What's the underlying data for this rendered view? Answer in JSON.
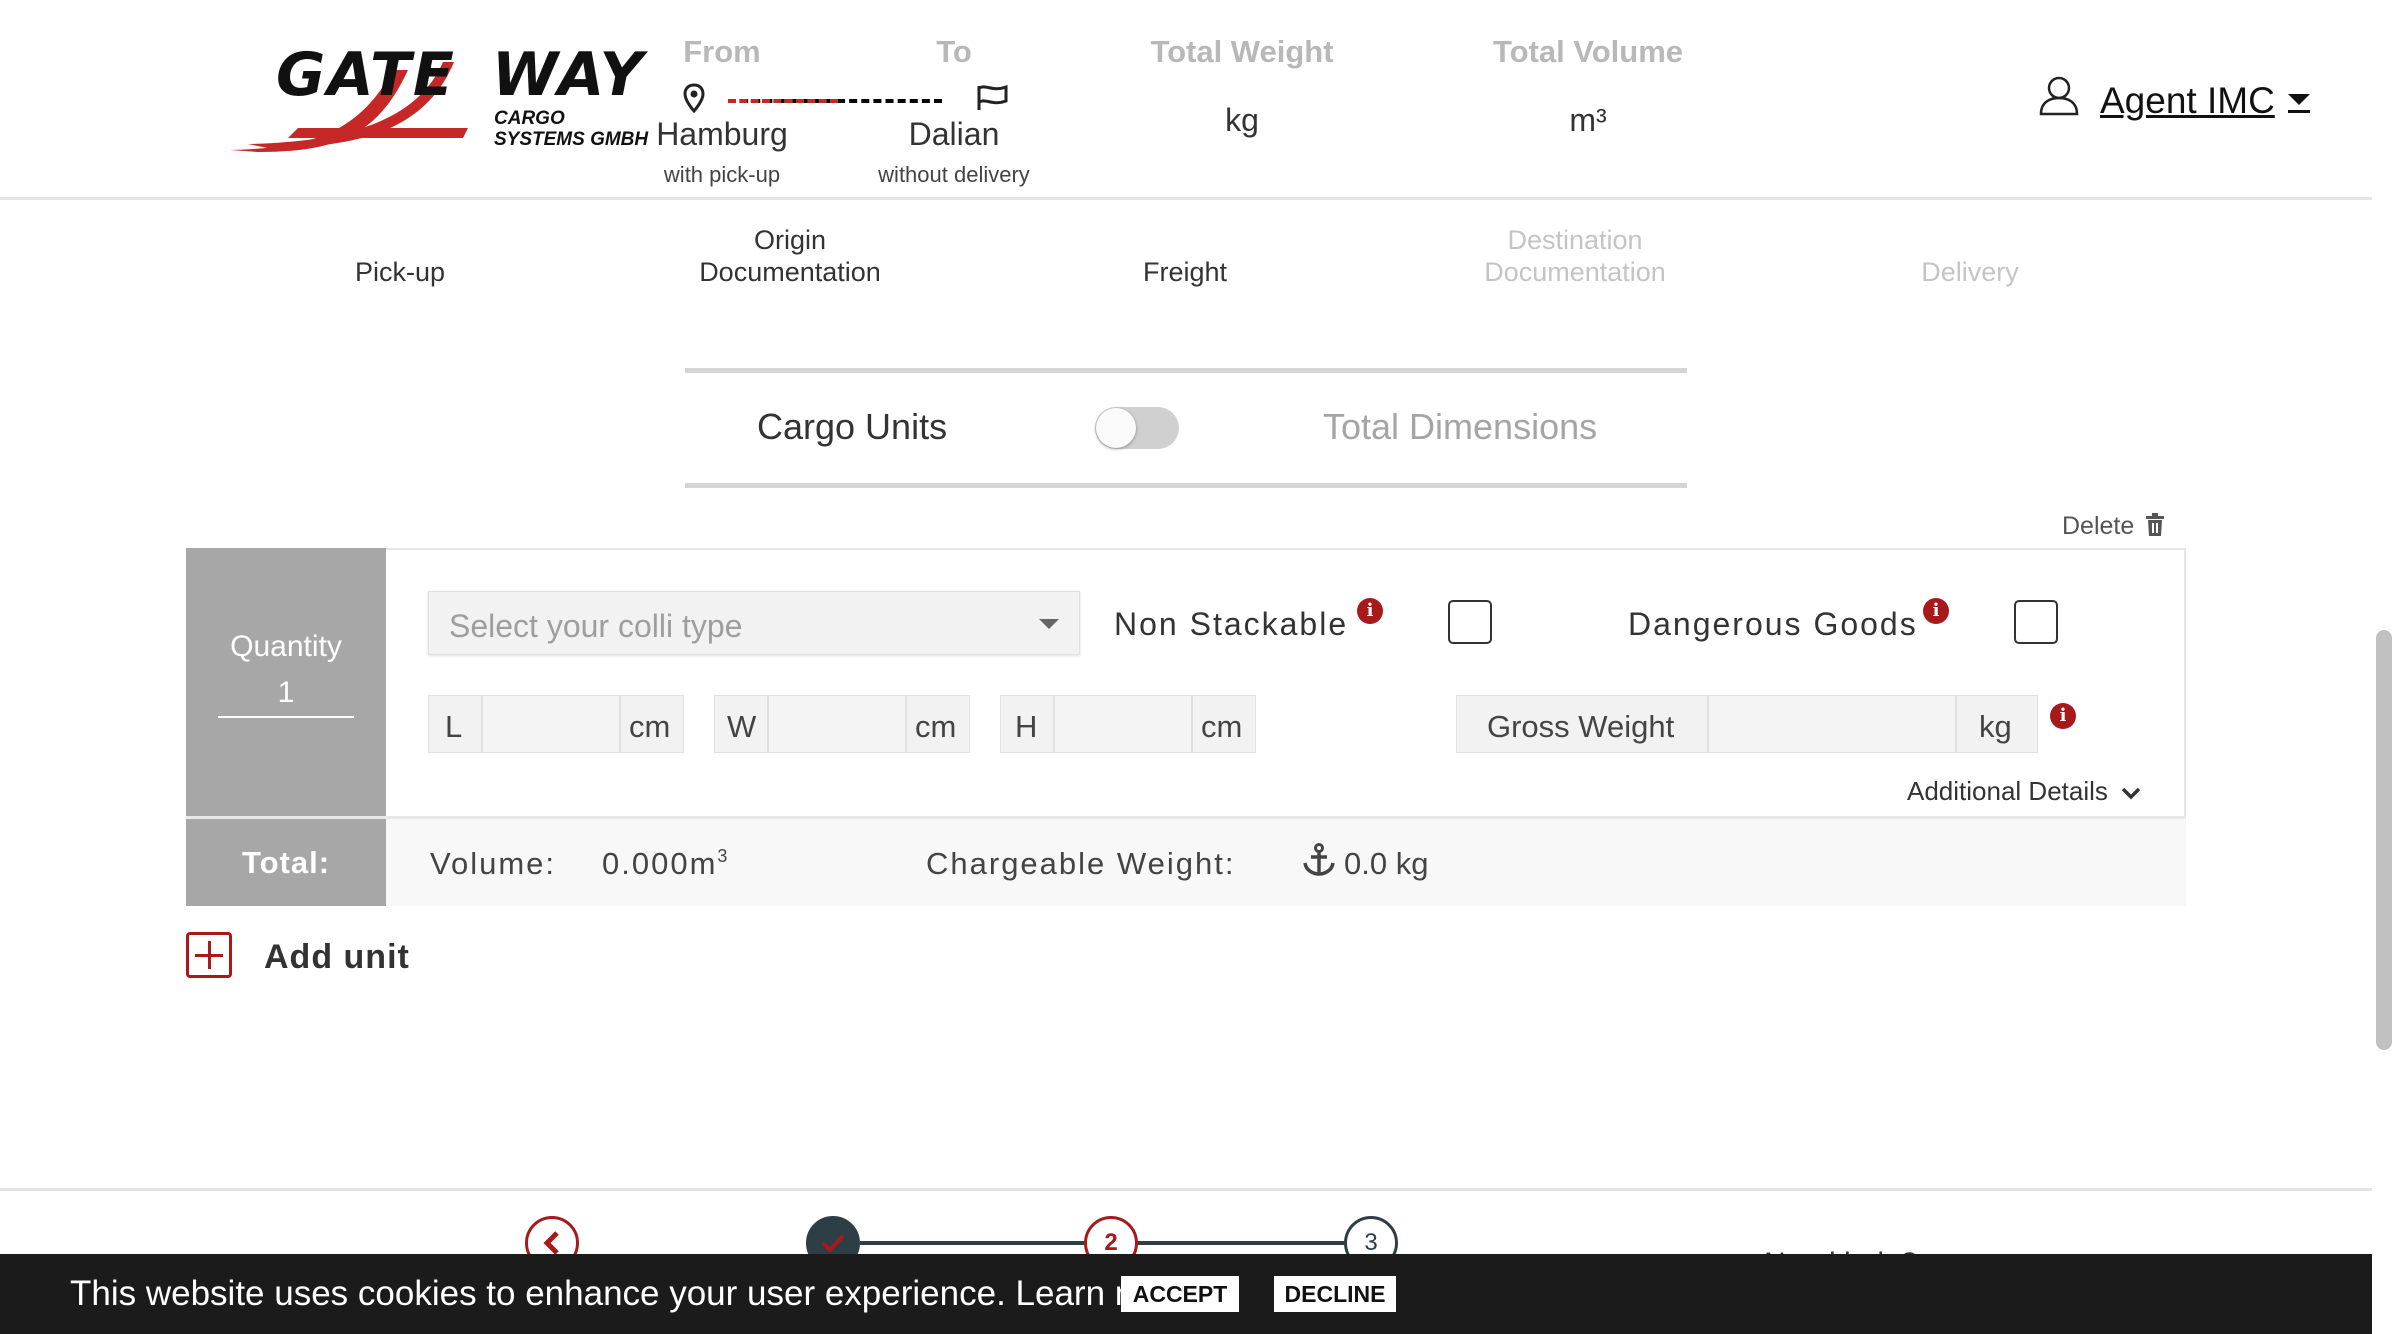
{
  "header": {
    "logo": {
      "word1": "GATE",
      "word2": "WAY",
      "sub1": "CARGO",
      "sub2": "SYSTEMS GMBH"
    },
    "from": {
      "label": "From",
      "value": "Hamburg",
      "sub": "with pick-up"
    },
    "to": {
      "label": "To",
      "value": "Dalian",
      "sub": "without delivery"
    },
    "total_weight": {
      "label": "Total Weight",
      "unit": "kg"
    },
    "total_volume": {
      "label": "Total Volume",
      "unit": "m³"
    },
    "user": {
      "name": "Agent IMC"
    }
  },
  "steps": [
    {
      "label": "Pick-up",
      "state": "active"
    },
    {
      "label": "Origin Documentation",
      "state": "active"
    },
    {
      "label": "Freight",
      "state": "active"
    },
    {
      "label": "Destination Documentation",
      "state": "inactive"
    },
    {
      "label": "Delivery",
      "state": "inactive"
    }
  ],
  "mode_toggle": {
    "left": "Cargo Units",
    "right": "Total Dimensions",
    "on": false
  },
  "unit": {
    "delete_label": "Delete",
    "quantity_label": "Quantity",
    "quantity_value": "1",
    "colli_placeholder": "Select your colli type",
    "non_stackable_label": "Non Stackable",
    "dangerous_goods_label": "Dangerous Goods",
    "length": {
      "label": "L",
      "unit": "cm",
      "value": ""
    },
    "width": {
      "label": "W",
      "unit": "cm",
      "value": ""
    },
    "height": {
      "label": "H",
      "unit": "cm",
      "value": ""
    },
    "gross_weight": {
      "label": "Gross Weight",
      "unit": "kg",
      "value": ""
    },
    "additional_details_label": "Additional Details",
    "total_label": "Total:",
    "volume_label": "Volume:",
    "volume_value": "0.000m",
    "volume_exp": "3",
    "chargeable_label": "Chargeable Weight:",
    "chargeable_value": "0.0 kg"
  },
  "add_unit_label": "Add unit",
  "progress": {
    "step2": "2",
    "step3": "3",
    "partial_text": "Need help?"
  },
  "cookie": {
    "text": "This website uses cookies to enhance your user experience. Learn more",
    "accept": "ACCEPT",
    "decline": "DECLINE"
  },
  "colors": {
    "brand_red": "#a8191b",
    "dark_teal": "#2d3e44",
    "grey_panel": "#a7a7a7"
  }
}
